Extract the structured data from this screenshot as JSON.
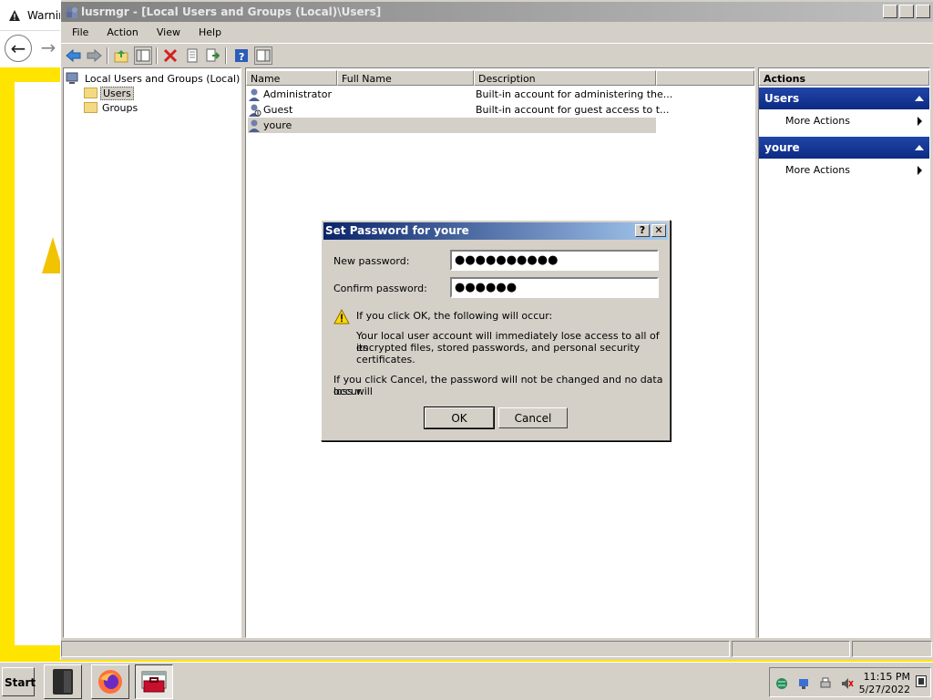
{
  "browser": {
    "tab_title": "Warnin",
    "back": "←",
    "forward": "→"
  },
  "window": {
    "title": "lusrmgr - [Local Users and Groups (Local)\\Users]",
    "buttons": {
      "minimize": "_",
      "maximize": "□",
      "close": "✕"
    }
  },
  "menu": [
    "File",
    "Action",
    "View",
    "Help"
  ],
  "tree": {
    "root": "Local Users and Groups (Local)",
    "items": [
      "Users",
      "Groups"
    ],
    "selected": "Users"
  },
  "list": {
    "columns": [
      "Name",
      "Full Name",
      "Description"
    ],
    "rows": [
      {
        "name": "Administrator",
        "full_name": "",
        "description": "Built-in account for administering the..."
      },
      {
        "name": "Guest",
        "full_name": "",
        "description": "Built-in account for guest access to t..."
      },
      {
        "name": "youre",
        "full_name": "",
        "description": ""
      }
    ]
  },
  "actions": {
    "header": "Actions",
    "sections": [
      {
        "title": "Users",
        "items": [
          "More Actions"
        ]
      },
      {
        "title": "youre",
        "items": [
          "More Actions"
        ]
      }
    ]
  },
  "dialog": {
    "title": "Set Password for youre",
    "help": "?",
    "close": "✕",
    "new_password_label": "New password:",
    "new_password_value": "●●●●●●●●●●",
    "confirm_password_label": "Confirm password:",
    "confirm_password_value": "●●●●●●",
    "warning_heading": "If you click OK, the following will occur:",
    "warning_line1": "Your local user account will immediately lose access to all of its",
    "warning_line2": "encrypted files, stored passwords, and personal security certificates.",
    "cancel_note_line1": "If you click Cancel, the password will not be changed and no data loss will",
    "cancel_note_line2": "occur.",
    "ok_label": "OK",
    "cancel_label": "Cancel"
  },
  "taskbar": {
    "start_label": "Start",
    "time": "11:15 PM",
    "date": "5/27/2022"
  }
}
